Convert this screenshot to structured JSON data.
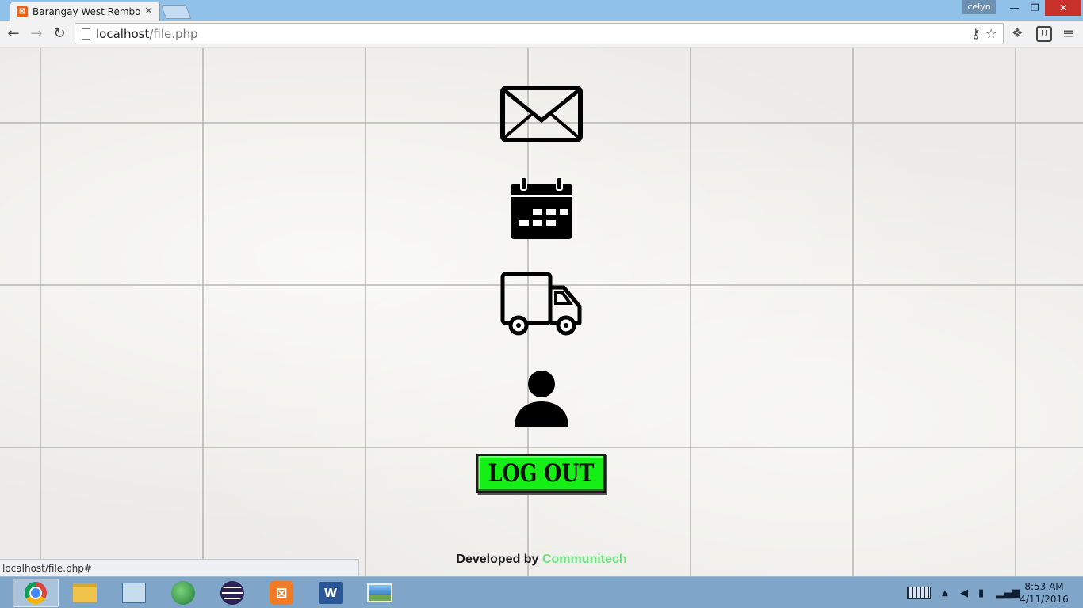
{
  "browser": {
    "tab_title": "Barangay West Rembo",
    "tab_close": "✕",
    "user": "celyn",
    "url_host": "localhost",
    "url_path": "/file.php",
    "status_url": "localhost/file.php#"
  },
  "nav": {
    "back": "←",
    "forward": "→",
    "reload": "↻"
  },
  "window_controls": {
    "minimize": "—",
    "maximize": "❐",
    "close": "✕"
  },
  "page": {
    "menu_icons": [
      "mail-icon",
      "calendar-icon",
      "truck-icon",
      "user-icon"
    ],
    "logout_label": "LOG OUT",
    "credit_prefix": "Developed by ",
    "credit_brand": "Communitech"
  },
  "taskbar": {
    "apps": [
      "Google Chrome",
      "File Explorer",
      "Control Panel",
      "Internet Download Manager",
      "Eclipse",
      "XAMPP",
      "Microsoft Word",
      "Photos"
    ],
    "time": "8:53 AM",
    "date": "4/11/2016"
  },
  "colors": {
    "logout_bg": "#15ef15",
    "brand": "#6ee27e",
    "taskbar": "#7fa5c8",
    "titlebar": "#8fc1e9"
  }
}
